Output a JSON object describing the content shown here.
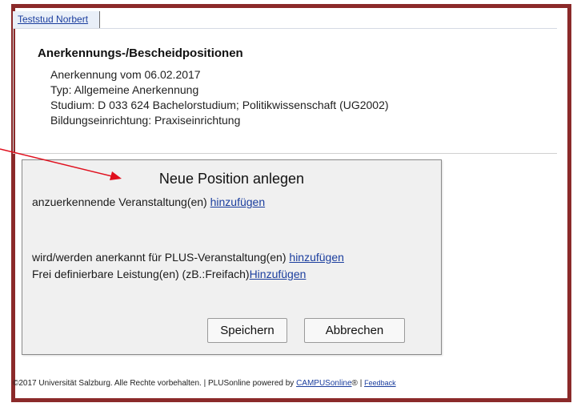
{
  "user_tab": {
    "label": "Teststud Norbert"
  },
  "info": {
    "title": "Anerkennungs-/Bescheidpositionen",
    "lines": [
      "Anerkennung vom 06.02.2017",
      "Typ: Allgemeine Anerkennung",
      "Studium: D 033 624 Bachelorstudium; Politikwissenschaft (UG2002)",
      "Bildungseinrichtung: Praxiseinrichtung"
    ]
  },
  "dialog": {
    "title": "Neue Position anlegen",
    "row1": {
      "text": "anzuerkennende Veranstaltung(en) ",
      "link": "hinzufügen"
    },
    "row2": {
      "text": "wird/werden anerkannt für PLUS-Veranstaltung(en) ",
      "link": "hinzufügen"
    },
    "row3": {
      "text": "Frei definierbare Leistung(en) (zB.:Freifach)",
      "link": "Hinzufügen"
    },
    "save_label": "Speichern",
    "cancel_label": "Abbrechen"
  },
  "footer": {
    "text": "©2017 Universität Salzburg. Alle Rechte vorbehalten. | PLUSonline powered by ",
    "campus_link": "CAMPUSonline",
    "reg": "® | ",
    "feedback_link": "Feedback"
  },
  "colors": {
    "frame_border": "#8b2a2a",
    "annotation_arrow": "#e0101e",
    "link": "#1b3e9e",
    "dialog_bg": "#f0f0f0"
  }
}
